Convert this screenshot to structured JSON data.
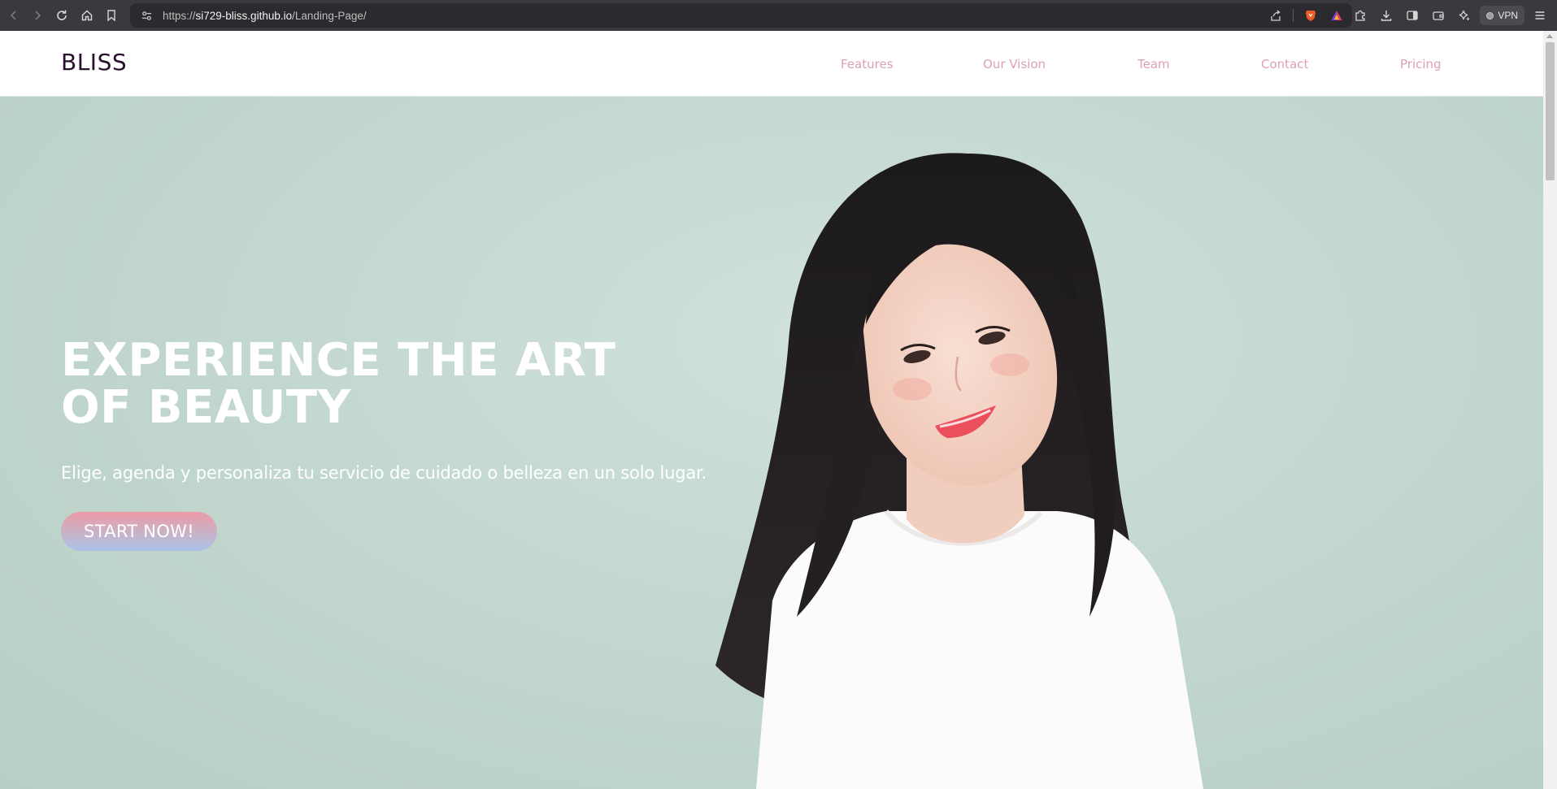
{
  "browser": {
    "url_scheme": "https://",
    "url_host": "si729-bliss.github.io",
    "url_path": "/Landing-Page/",
    "vpn_label": "VPN"
  },
  "site": {
    "logo": "BLISS",
    "nav": [
      "Features",
      "Our Vision",
      "Team",
      "Contact",
      "Pricing"
    ]
  },
  "hero": {
    "title": "EXPERIENCE THE ART OF BEAUTY",
    "subtitle": "Elige, agenda y personaliza tu servicio de cuidado o belleza en un solo lugar.",
    "cta_label": "START NOW!"
  },
  "colors": {
    "logo": "#2a0f2e",
    "nav_link": "#dda0b4",
    "hero_bg": "#c3d8cf",
    "cta_gradient_top": "#ec9aa6",
    "cta_gradient_bottom": "#a9c2ea"
  }
}
